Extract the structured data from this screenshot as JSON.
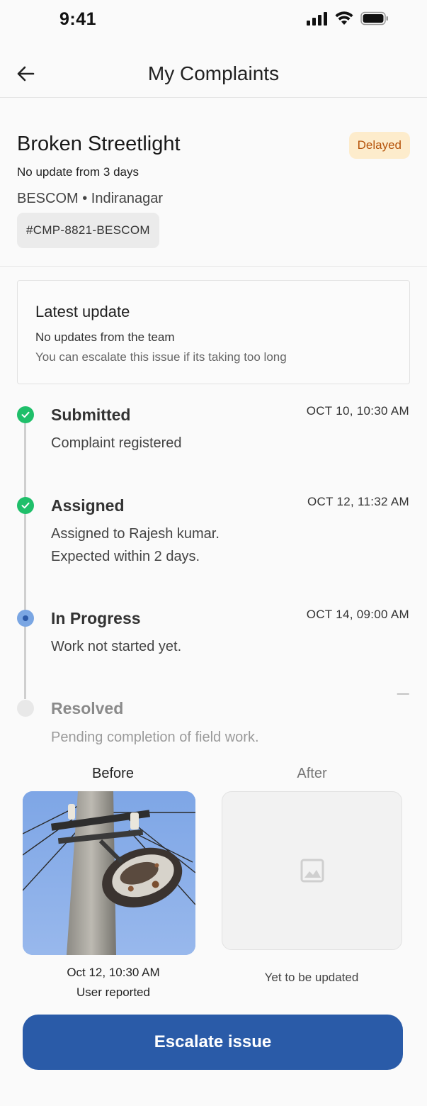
{
  "status_bar": {
    "time": "9:41"
  },
  "nav": {
    "title": "My Complaints"
  },
  "complaint": {
    "title": "Broken Streetlight",
    "status_badge": "Delayed",
    "subtitle": "No update from 3 days",
    "location": "BESCOM • Indiranagar",
    "id": "#CMP-8821-BESCOM"
  },
  "latest_update": {
    "title": "Latest update",
    "line1": "No updates from the team",
    "line2": "You can escalate this issue if its taking too long"
  },
  "timeline": [
    {
      "title": "Submitted",
      "time": "OCT 10, 10:30 AM",
      "desc": "Complaint registered",
      "state": "done"
    },
    {
      "title": "Assigned",
      "time": "OCT 12, 11:32 AM",
      "desc1": "Assigned to Rajesh kumar.",
      "desc2": "Expected within 2 days.",
      "state": "done"
    },
    {
      "title": "In Progress",
      "time": "OCT 14, 09:00 AM",
      "desc": "Work not started yet.",
      "state": "in-progress"
    },
    {
      "title": "Resolved",
      "time": "—",
      "desc": "Pending completion of field work.",
      "state": "pending"
    }
  ],
  "photos": {
    "before_label": "Before",
    "after_label": "After",
    "before_date": "Oct 12, 10:30 AM",
    "before_by": "User reported",
    "after_status": "Yet to be updated"
  },
  "actions": {
    "escalate_label": "Escalate issue"
  },
  "colors": {
    "accent": "#2a5ba8",
    "done": "#1fbf6a",
    "delayed_bg": "#fdeccc",
    "delayed_text": "#b5530a"
  }
}
